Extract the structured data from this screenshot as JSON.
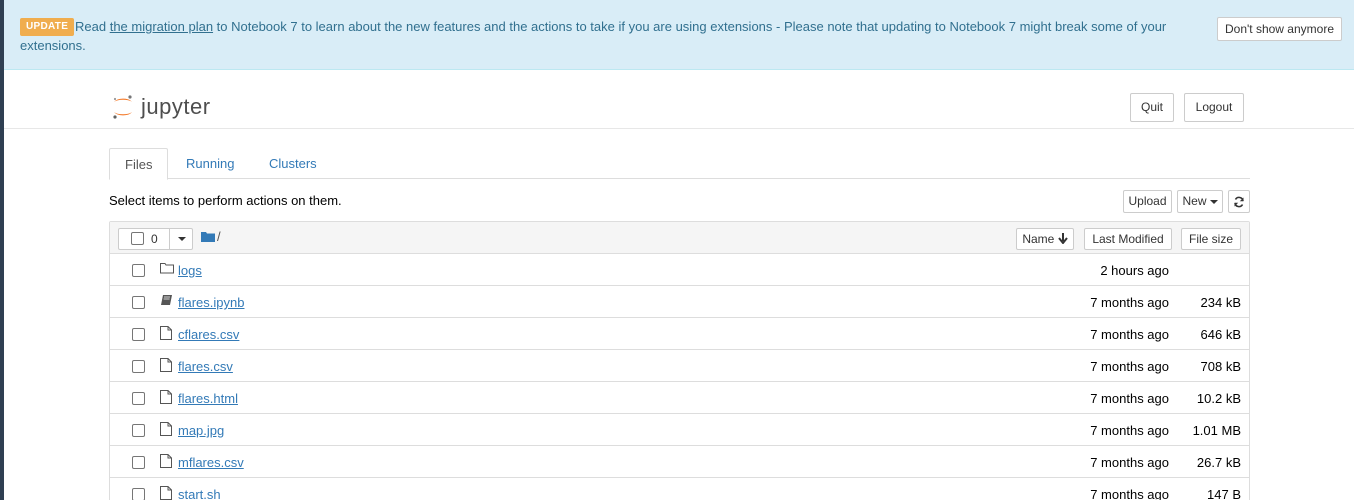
{
  "banner": {
    "badge": "UPDATE",
    "text_before": "Read ",
    "link": "the migration plan",
    "text_after": " to Notebook 7 to learn about the new features and the actions to take if you are using extensions - Please note that updating to Notebook 7 might break some of your extensions.",
    "dismiss": "Don't show anymore"
  },
  "header": {
    "logo_text": "jupyter",
    "quit": "Quit",
    "logout": "Logout"
  },
  "tabs": [
    {
      "label": "Files",
      "active": true
    },
    {
      "label": "Running",
      "active": false
    },
    {
      "label": "Clusters",
      "active": false
    }
  ],
  "toolbar": {
    "hint": "Select items to perform actions on them.",
    "upload": "Upload",
    "new": "New"
  },
  "list_header": {
    "selected_count": "0",
    "path": "/",
    "col_name": "Name",
    "col_modified": "Last Modified",
    "col_size": "File size"
  },
  "files": [
    {
      "name": "logs",
      "type": "folder",
      "modified": "2 hours ago",
      "size": ""
    },
    {
      "name": "flares.ipynb",
      "type": "notebook",
      "modified": "7 months ago",
      "size": "234 kB"
    },
    {
      "name": "cflares.csv",
      "type": "file",
      "modified": "7 months ago",
      "size": "646 kB"
    },
    {
      "name": "flares.csv",
      "type": "file",
      "modified": "7 months ago",
      "size": "708 kB"
    },
    {
      "name": "flares.html",
      "type": "file",
      "modified": "7 months ago",
      "size": "10.2 kB"
    },
    {
      "name": "map.jpg",
      "type": "file",
      "modified": "7 months ago",
      "size": "1.01 MB"
    },
    {
      "name": "mflares.csv",
      "type": "file",
      "modified": "7 months ago",
      "size": "26.7 kB"
    },
    {
      "name": "start.sh",
      "type": "file",
      "modified": "7 months ago",
      "size": "147 B"
    }
  ]
}
